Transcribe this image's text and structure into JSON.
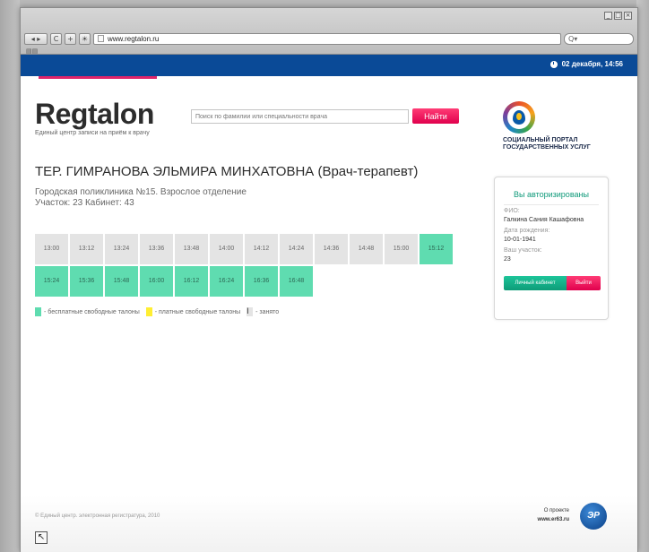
{
  "browser": {
    "window_controls": [
      "_",
      "□",
      "×"
    ],
    "nav_buttons": [
      "◂ ▸",
      "C",
      "+",
      "☀"
    ],
    "url": "www.regtalon.ru",
    "search_placeholder": "Q▾",
    "bookmark_icon": "book-icon"
  },
  "topbar": {
    "date_time": "02 декабря, 14:56",
    "accent_color": "#e0246a",
    "bar_color": "#0a4a97"
  },
  "header": {
    "logo": "Regtalon",
    "logo_subtitle": "Единый центр записи на приём к врачу",
    "search_placeholder": "Поиск по фамилии или специальности врача",
    "search_button": "Найти",
    "portal_title": "СОЦИАЛЬНЫЙ ПОРТАЛ ГОСУДАРСТВЕННЫХ УСЛУГ"
  },
  "doctor": {
    "name": "ТЕР. ГИМРАНОВА ЭЛЬМИРА МИНХАТОВНА (Врач-терапевт)",
    "clinic": "Городская поликлиника №15. Взрослое отделение",
    "room": "Участок: 23  Кабинет: 43"
  },
  "slots": [
    {
      "time": "13:00",
      "status": "busy"
    },
    {
      "time": "13:12",
      "status": "busy"
    },
    {
      "time": "13:24",
      "status": "busy"
    },
    {
      "time": "13:36",
      "status": "busy"
    },
    {
      "time": "13:48",
      "status": "busy"
    },
    {
      "time": "14:00",
      "status": "busy"
    },
    {
      "time": "14:12",
      "status": "busy"
    },
    {
      "time": "14:24",
      "status": "busy"
    },
    {
      "time": "14:36",
      "status": "busy"
    },
    {
      "time": "14:48",
      "status": "busy"
    },
    {
      "time": "15:00",
      "status": "busy"
    },
    {
      "time": "15:12",
      "status": "free"
    },
    {
      "time": "15:24",
      "status": "free"
    },
    {
      "time": "15:36",
      "status": "free"
    },
    {
      "time": "15:48",
      "status": "free"
    },
    {
      "time": "16:00",
      "status": "free"
    },
    {
      "time": "16:12",
      "status": "free"
    },
    {
      "time": "16:24",
      "status": "free"
    },
    {
      "time": "16:36",
      "status": "free"
    },
    {
      "time": "16:48",
      "status": "free"
    }
  ],
  "legend": [
    {
      "color": "#5fdcb0",
      "label": "- бесплатные свободные талоны"
    },
    {
      "color": "#ffee33",
      "label": "- платные свободные талоны"
    },
    {
      "color": "#e4e4e4",
      "label": "- занято"
    }
  ],
  "auth": {
    "title": "Вы авторизированы",
    "fio_label": "ФИО:",
    "fio_value": "Галкина Сания Кашафовна",
    "dob_label": "Дата рождения:",
    "dob_value": "10-01-1941",
    "district_label": "Ваш участок:",
    "district_value": "23",
    "cabinet_button": "Личный кабинет",
    "logout_button": "Выйти"
  },
  "footer": {
    "copyright": "© Единый центр. электронная регистратура, 2010",
    "about": "О проекте",
    "about_url": "www.er63.ru",
    "er_logo": "ЭР"
  },
  "corner_arrow": "↖",
  "cursor": "I"
}
